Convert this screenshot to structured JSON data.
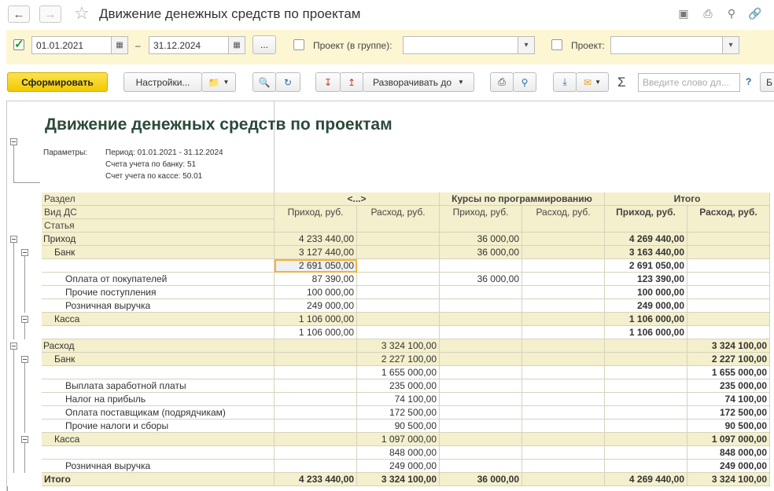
{
  "window": {
    "title": "Движение денежных средств по проектам"
  },
  "filters": {
    "period_from": "01.01.2021",
    "period_dash": "–",
    "period_to": "31.12.2024",
    "more_label": "...",
    "project_group_label": "Проект (в группе):",
    "project_group_value": "",
    "project_label": "Проект:",
    "project_value": ""
  },
  "toolbar": {
    "generate": "Сформировать",
    "settings": "Настройки...",
    "expand_label": "Разворачивать до",
    "search_placeholder": "Введите слово дл...",
    "help": "?",
    "sigma": "Σ",
    "next": "Б"
  },
  "report": {
    "title": "Движение денежных средств по проектам",
    "params_label": "Параметры:",
    "params": [
      "Период: 01.01.2021 - 31.12.2024",
      "Счета учета по банку: 51",
      "Счет учета по кассе: 50.01"
    ],
    "row_headers": [
      "Раздел",
      "Вид ДС",
      "Статья"
    ],
    "groups": [
      "<...>",
      "Курсы по программированию",
      "Итого"
    ],
    "subcols": [
      "Приход, руб.",
      "Расход, руб.",
      "Приход, руб.",
      "Расход, руб.",
      "Приход, руб.",
      "Расход, руб."
    ],
    "rows": [
      {
        "label": "Приход",
        "level": 0,
        "vals": [
          "4 233 440,00",
          "",
          "36 000,00",
          "",
          "4 269 440,00",
          ""
        ]
      },
      {
        "label": "Банк",
        "level": 1,
        "vals": [
          "3 127 440,00",
          "",
          "36 000,00",
          "",
          "3 163 440,00",
          ""
        ]
      },
      {
        "label": "",
        "level": 2,
        "vals": [
          "2 691 050,00",
          "",
          "",
          "",
          "2 691 050,00",
          ""
        ]
      },
      {
        "label": "Оплата от покупателей",
        "level": 2,
        "vals": [
          "87 390,00",
          "",
          "36 000,00",
          "",
          "123 390,00",
          ""
        ]
      },
      {
        "label": "Прочие поступления",
        "level": 2,
        "vals": [
          "100 000,00",
          "",
          "",
          "",
          "100 000,00",
          ""
        ]
      },
      {
        "label": "Розничная выручка",
        "level": 2,
        "vals": [
          "249 000,00",
          "",
          "",
          "",
          "249 000,00",
          ""
        ]
      },
      {
        "label": "Касса",
        "level": 1,
        "vals": [
          "1 106 000,00",
          "",
          "",
          "",
          "1 106 000,00",
          ""
        ]
      },
      {
        "label": "",
        "level": 2,
        "vals": [
          "1 106 000,00",
          "",
          "",
          "",
          "1 106 000,00",
          ""
        ]
      },
      {
        "label": "Расход",
        "level": 0,
        "vals": [
          "",
          "3 324 100,00",
          "",
          "",
          "",
          "3 324 100,00"
        ]
      },
      {
        "label": "Банк",
        "level": 1,
        "vals": [
          "",
          "2 227 100,00",
          "",
          "",
          "",
          "2 227 100,00"
        ]
      },
      {
        "label": "",
        "level": 2,
        "vals": [
          "",
          "1 655 000,00",
          "",
          "",
          "",
          "1 655 000,00"
        ]
      },
      {
        "label": "Выплата заработной платы",
        "level": 2,
        "vals": [
          "",
          "235 000,00",
          "",
          "",
          "",
          "235 000,00"
        ]
      },
      {
        "label": "Налог на прибыль",
        "level": 2,
        "vals": [
          "",
          "74 100,00",
          "",
          "",
          "",
          "74 100,00"
        ]
      },
      {
        "label": "Оплата поставщикам (подрядчикам)",
        "level": 2,
        "vals": [
          "",
          "172 500,00",
          "",
          "",
          "",
          "172 500,00"
        ]
      },
      {
        "label": "Прочие налоги и сборы",
        "level": 2,
        "vals": [
          "",
          "90 500,00",
          "",
          "",
          "",
          "90 500,00"
        ]
      },
      {
        "label": "Касса",
        "level": 1,
        "vals": [
          "",
          "1 097 000,00",
          "",
          "",
          "",
          "1 097 000,00"
        ]
      },
      {
        "label": "",
        "level": 2,
        "vals": [
          "",
          "848 000,00",
          "",
          "",
          "",
          "848 000,00"
        ]
      },
      {
        "label": "Розничная выручка",
        "level": 2,
        "vals": [
          "",
          "249 000,00",
          "",
          "",
          "",
          "249 000,00"
        ]
      }
    ],
    "total": {
      "label": "Итого",
      "vals": [
        "4 233 440,00",
        "3 324 100,00",
        "36 000,00",
        "",
        "4 269 440,00",
        "3 324 100,00"
      ]
    }
  }
}
